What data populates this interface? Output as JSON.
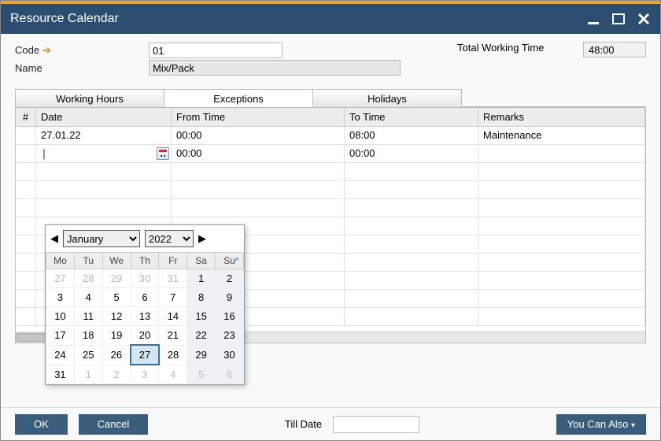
{
  "window": {
    "title": "Resource Calendar"
  },
  "form": {
    "code_label": "Code",
    "code_value": "01",
    "name_label": "Name",
    "name_value": "Mix/Pack",
    "twt_label": "Total Working Time",
    "twt_value": "48:00"
  },
  "tabs": {
    "working_hours": "Working Hours",
    "exceptions": "Exceptions",
    "holidays": "Holidays"
  },
  "grid": {
    "headers": {
      "hash": "#",
      "date": "Date",
      "from": "From Time",
      "to": "To Time",
      "remarks": "Remarks"
    },
    "rows": [
      {
        "date": "27.01.22",
        "from": "00:00",
        "to": "08:00",
        "remarks": "Maintenance"
      },
      {
        "date": "",
        "from": "00:00",
        "to": "00:00",
        "remarks": ""
      }
    ]
  },
  "datepicker": {
    "month": "January",
    "year": "2022",
    "weekdays": [
      "Mo",
      "Tu",
      "We",
      "Th",
      "Fr",
      "Sa",
      "Su"
    ],
    "cells": [
      [
        {
          "d": "27",
          "o": true
        },
        {
          "d": "28",
          "o": true
        },
        {
          "d": "29",
          "o": true
        },
        {
          "d": "30",
          "o": true
        },
        {
          "d": "31",
          "o": true
        },
        {
          "d": "1",
          "w": true
        },
        {
          "d": "2",
          "w": true
        }
      ],
      [
        {
          "d": "3"
        },
        {
          "d": "4"
        },
        {
          "d": "5"
        },
        {
          "d": "6"
        },
        {
          "d": "7"
        },
        {
          "d": "8",
          "w": true
        },
        {
          "d": "9",
          "w": true
        }
      ],
      [
        {
          "d": "10"
        },
        {
          "d": "11"
        },
        {
          "d": "12"
        },
        {
          "d": "13"
        },
        {
          "d": "14"
        },
        {
          "d": "15",
          "w": true
        },
        {
          "d": "16",
          "w": true
        }
      ],
      [
        {
          "d": "17"
        },
        {
          "d": "18"
        },
        {
          "d": "19"
        },
        {
          "d": "20"
        },
        {
          "d": "21"
        },
        {
          "d": "22",
          "w": true
        },
        {
          "d": "23",
          "w": true
        }
      ],
      [
        {
          "d": "24"
        },
        {
          "d": "25"
        },
        {
          "d": "26"
        },
        {
          "d": "27",
          "sel": true
        },
        {
          "d": "28"
        },
        {
          "d": "29",
          "w": true
        },
        {
          "d": "30",
          "w": true
        }
      ],
      [
        {
          "d": "31"
        },
        {
          "d": "1",
          "o": true
        },
        {
          "d": "2",
          "o": true
        },
        {
          "d": "3",
          "o": true
        },
        {
          "d": "4",
          "o": true
        },
        {
          "d": "5",
          "o": true,
          "w": true
        },
        {
          "d": "6",
          "o": true,
          "w": true
        }
      ]
    ]
  },
  "footer": {
    "ok": "OK",
    "cancel": "Cancel",
    "till_date": "Till Date",
    "you_can_also": "You Can Also"
  }
}
